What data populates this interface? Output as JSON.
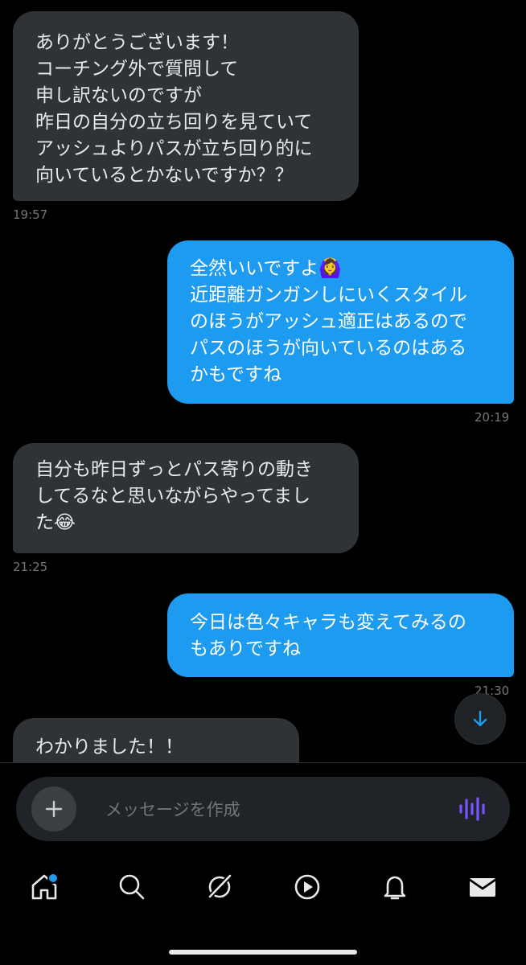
{
  "messages": [
    {
      "text": "ありがとうございます！\nコーチング外で質問して\n申し訳ないのですが\n昨日の自分の立ち回りを見ていて\nアッシュよりパスが立ち回り的に\n向いているとかないですか？？",
      "time": "19:57"
    },
    {
      "text": "全然いいですよ🙆‍♀️\n近距離ガンガンしにいくスタイル\nのほうがアッシュ適正はあるので\nパスのほうが向いているのはある\nかもですね",
      "time": "20:19"
    },
    {
      "text": "自分も昨日ずっとパス寄りの動き\nしてるなと思いながらやってまし\nた😂",
      "time": "21:25"
    },
    {
      "text": "今日は色々キャラも変えてみるの\nもありですね",
      "time": "21:30"
    },
    {
      "text": "わかりました！！\nいろいろ試 …"
    }
  ],
  "composer": {
    "placeholder": "メッセージを作成"
  },
  "icons": {
    "scroll_down": "arrow-down-icon",
    "add": "plus-icon",
    "voice": "voice-wave-icon",
    "tabs": [
      "home-icon",
      "search-icon",
      "grok-icon",
      "play-icon",
      "bell-icon",
      "mail-icon"
    ]
  },
  "colors": {
    "accent": "#1d9bf0",
    "incoming_bubble": "#2f3336",
    "voice": "#7856ff"
  }
}
